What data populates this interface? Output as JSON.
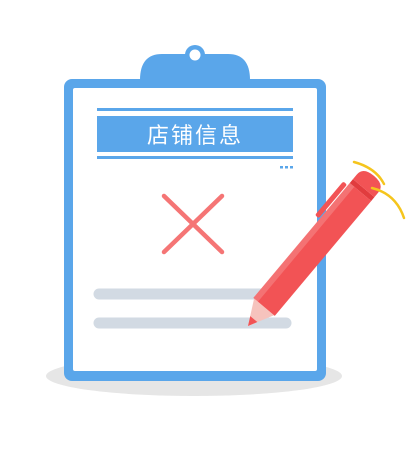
{
  "card": {
    "title": "店铺信息",
    "status_icon": "close-icon"
  },
  "colors": {
    "clipboard_border": "#5aa6ea",
    "title_band": "#5aa6ea",
    "cross": "#f57575",
    "placeholder_lines": "#d2dae3",
    "pencil_body": "#f25355",
    "pencil_tip": "#f6c3bd",
    "spark_lines": "#f5c51d",
    "shadow": "#e6e6e6"
  }
}
